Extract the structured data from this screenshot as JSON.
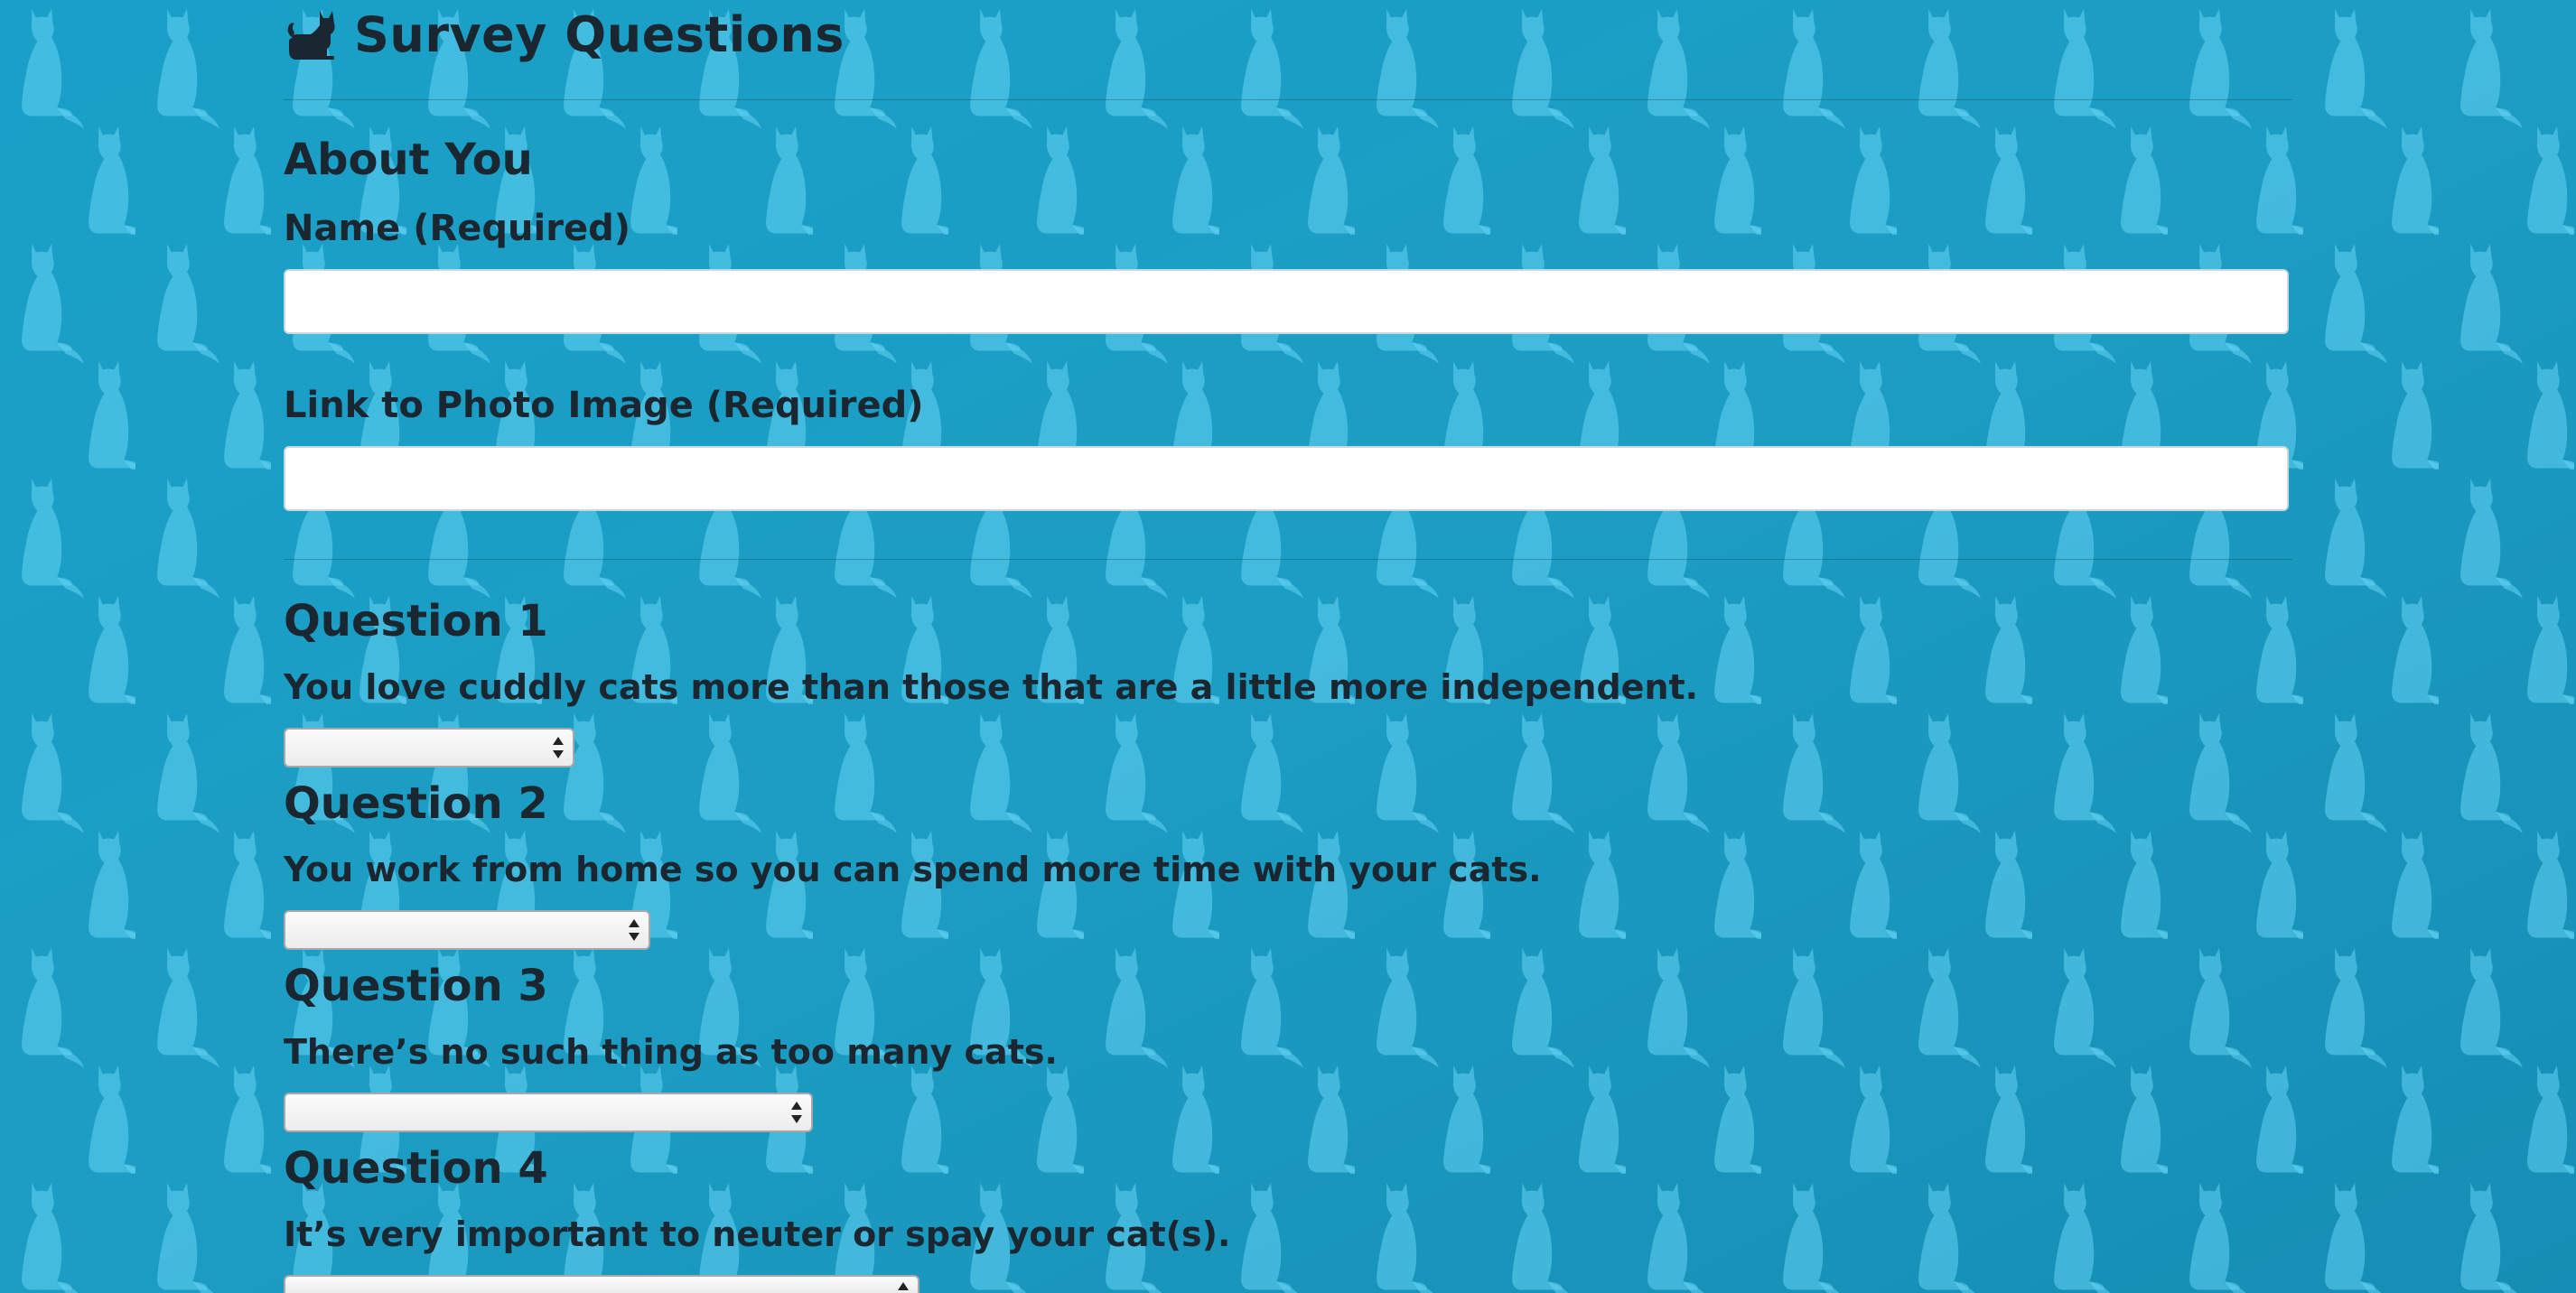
{
  "header": {
    "title": "Survey Questions",
    "title_icon": "cat-icon"
  },
  "about": {
    "heading": "About You",
    "name_label": "Name (Required)",
    "name_value": "",
    "photo_label": "Link to Photo Image (Required)",
    "photo_value": ""
  },
  "questions": [
    {
      "heading": "Question 1",
      "text": "You love cuddly cats more than those that are a little more independent.",
      "selected": ""
    },
    {
      "heading": "Question 2",
      "text": "You work from home so you can spend more time with your cats.",
      "selected": ""
    },
    {
      "heading": "Question 3",
      "text": "There’s no such thing as too many cats.",
      "selected": ""
    },
    {
      "heading": "Question 4",
      "text": "It’s very important to neuter or spay your cat(s).",
      "selected": ""
    }
  ],
  "theme": {
    "background": "#1a9ec4",
    "cat_pattern_color": "#5fd0f2",
    "text_color": "#1b2730"
  }
}
